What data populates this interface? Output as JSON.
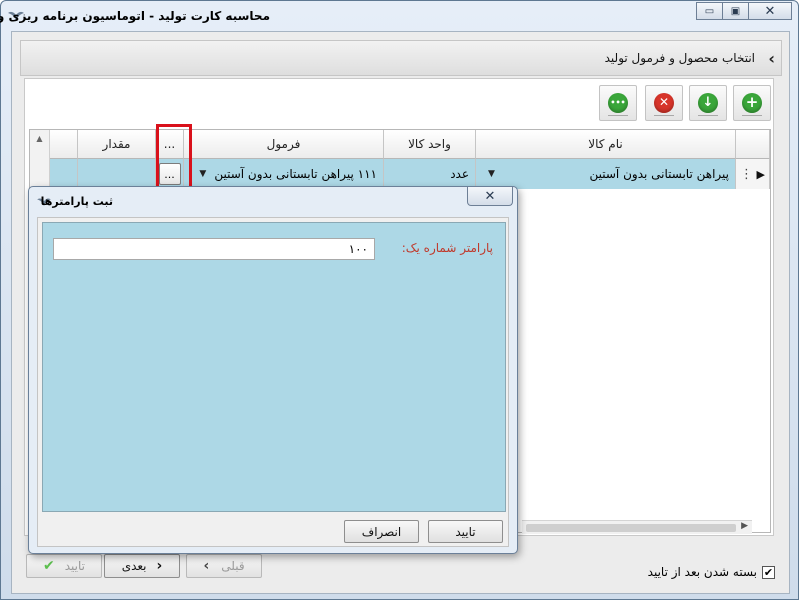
{
  "window": {
    "title": "محاسبه کارت تولید - اتوماسیون برنامه ریزی و تولید",
    "minimize_icon": "minimize-icon",
    "maximize_icon": "maximize-icon",
    "close_icon": "close-icon",
    "close_glyph": "✕",
    "minimize_glyph": "▭",
    "maximize_glyph": "▣"
  },
  "header": {
    "title": "انتخاب محصول و فرمول تولید",
    "chevron": "‹"
  },
  "toolbar": {
    "buttons": [
      {
        "name": "add",
        "glyph": "+",
        "color": "#3aa63a"
      },
      {
        "name": "move-down",
        "glyph": "↓",
        "color": "#3aa63a"
      },
      {
        "name": "delete",
        "glyph": "✕",
        "color": "#d7342a"
      },
      {
        "name": "more",
        "glyph": "•••",
        "color": "#3aa63a"
      }
    ]
  },
  "grid": {
    "columns": {
      "product_name": "نام کالا",
      "unit": "واحد کالا",
      "formula": "فرمول",
      "params": "...",
      "quantity": "مقدار"
    },
    "rows": [
      {
        "product_name": "پیراهن تابستانی بدون آستین",
        "unit": "عدد",
        "formula": "۱۱۱ پیراهن تابستانی بدون آستین",
        "params": "...",
        "quantity": ""
      }
    ],
    "row_indicator": "▶",
    "row_dots": "⋮"
  },
  "footer": {
    "confirm_label": "تایید",
    "next_label": "بعدی",
    "prev_label": "قبلی",
    "close_after_confirm_label": "بسته شدن بعد از تایید",
    "close_after_confirm_checked": true
  },
  "dialog": {
    "title": "ثبت پارامترها",
    "param_label": "پارامتر شماره یک:",
    "param_value": "۱۰۰",
    "ok_label": "تایید",
    "cancel_label": "انصراف"
  },
  "colors": {
    "selection": "#add8e6",
    "highlight_box": "#d9111b",
    "param_label": "#c0392b"
  }
}
